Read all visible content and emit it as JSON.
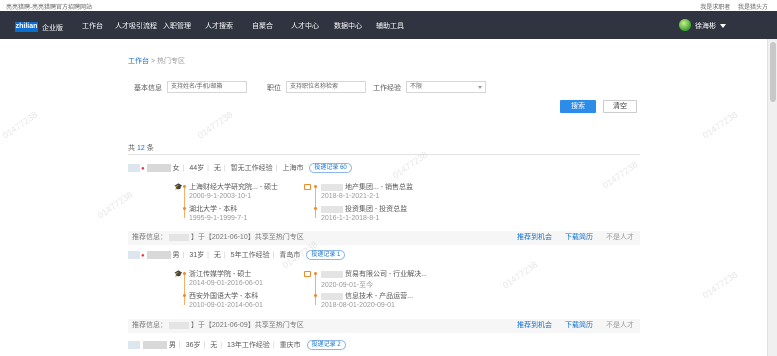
{
  "top_strip": {
    "welcome": "亮亮猎聘-亮亮猎聘官方招聘网站",
    "links": [
      "我是求职者",
      "我是猎头方"
    ]
  },
  "nav": {
    "logo": "zhilian",
    "logo_sub": "企业版",
    "items": [
      "工作台",
      "人才吸引流程",
      "入职管理",
      "人才搜索",
      "自聚合",
      "人才中心",
      "数据中心",
      "辅助工具"
    ],
    "user": "徐海彬"
  },
  "breadcrumb": {
    "parent": "工作台",
    "sep": ">",
    "current": "热门专区"
  },
  "filters": {
    "basic_label": "基本信息",
    "basic_placeholder": "支持姓名/手机/邮箱",
    "position_label": "职位",
    "position_placeholder": "支持职位名称检索",
    "experience_label": "工作经验",
    "experience_value": "不限",
    "search_button": "搜索",
    "clear_button": "清空"
  },
  "results": {
    "total_prefix": "共",
    "total_count": "12",
    "total_suffix": "条",
    "candidates": [
      {
        "gender": "女",
        "age": "44岁",
        "marital": "无",
        "experience": "暂无工作经验",
        "city": "上海市",
        "tag": "投递记录 60",
        "edu": [
          {
            "school": "上海财经大学研究院... - 硕士",
            "date": "2000-9-1-2003-10-1"
          },
          {
            "school": "湖北大学 - 本科",
            "date": "1995-9-1-1999-7-1"
          }
        ],
        "work": [
          {
            "company": "地产集团... - 销售总监",
            "date": "2018-8-1-2021-2-1"
          },
          {
            "company": "投资集团 - 投资总监",
            "date": "2016-1-1-2018-8-1"
          }
        ],
        "recommend_prefix": "推荐信息：",
        "recommend_suffix": "】于【2021-06-10】共享至热门专区",
        "actions": [
          "推荐到机会",
          "下载简历",
          "不是人才"
        ]
      },
      {
        "gender": "男",
        "age": "31岁",
        "marital": "无",
        "experience": "5年工作经验",
        "city": "青岛市",
        "tag": "投递记录 1",
        "edu": [
          {
            "school": "浙江传媒学院 - 硕士",
            "date": "2014-09-01-2016-06-01"
          },
          {
            "school": "西安外国语大学 - 本科",
            "date": "2010-09-01-2014-06-01"
          }
        ],
        "work": [
          {
            "company": "贸易有限公司 - 行业解决...",
            "date": "2020-09-01-至今"
          },
          {
            "company": "信息技术 - 产品运营...",
            "date": "2018-08-01-2020-09-01"
          }
        ],
        "recommend_prefix": "推荐信息：",
        "recommend_suffix": "】于【2021-06-09】共享至热门专区",
        "actions": [
          "推荐到机会",
          "下载简历",
          "不是人才"
        ]
      },
      {
        "gender": "男",
        "age": "36岁",
        "marital": "无",
        "experience": "13年工作经验",
        "city": "重庆市",
        "tag": "投递记录 2"
      }
    ]
  },
  "watermark": "01477238",
  "colors": {
    "nav_bg": "#2f3440",
    "accent": "#0b6fd1",
    "search_btn": "#2d8ce8",
    "timeline": "#f08b2a"
  }
}
